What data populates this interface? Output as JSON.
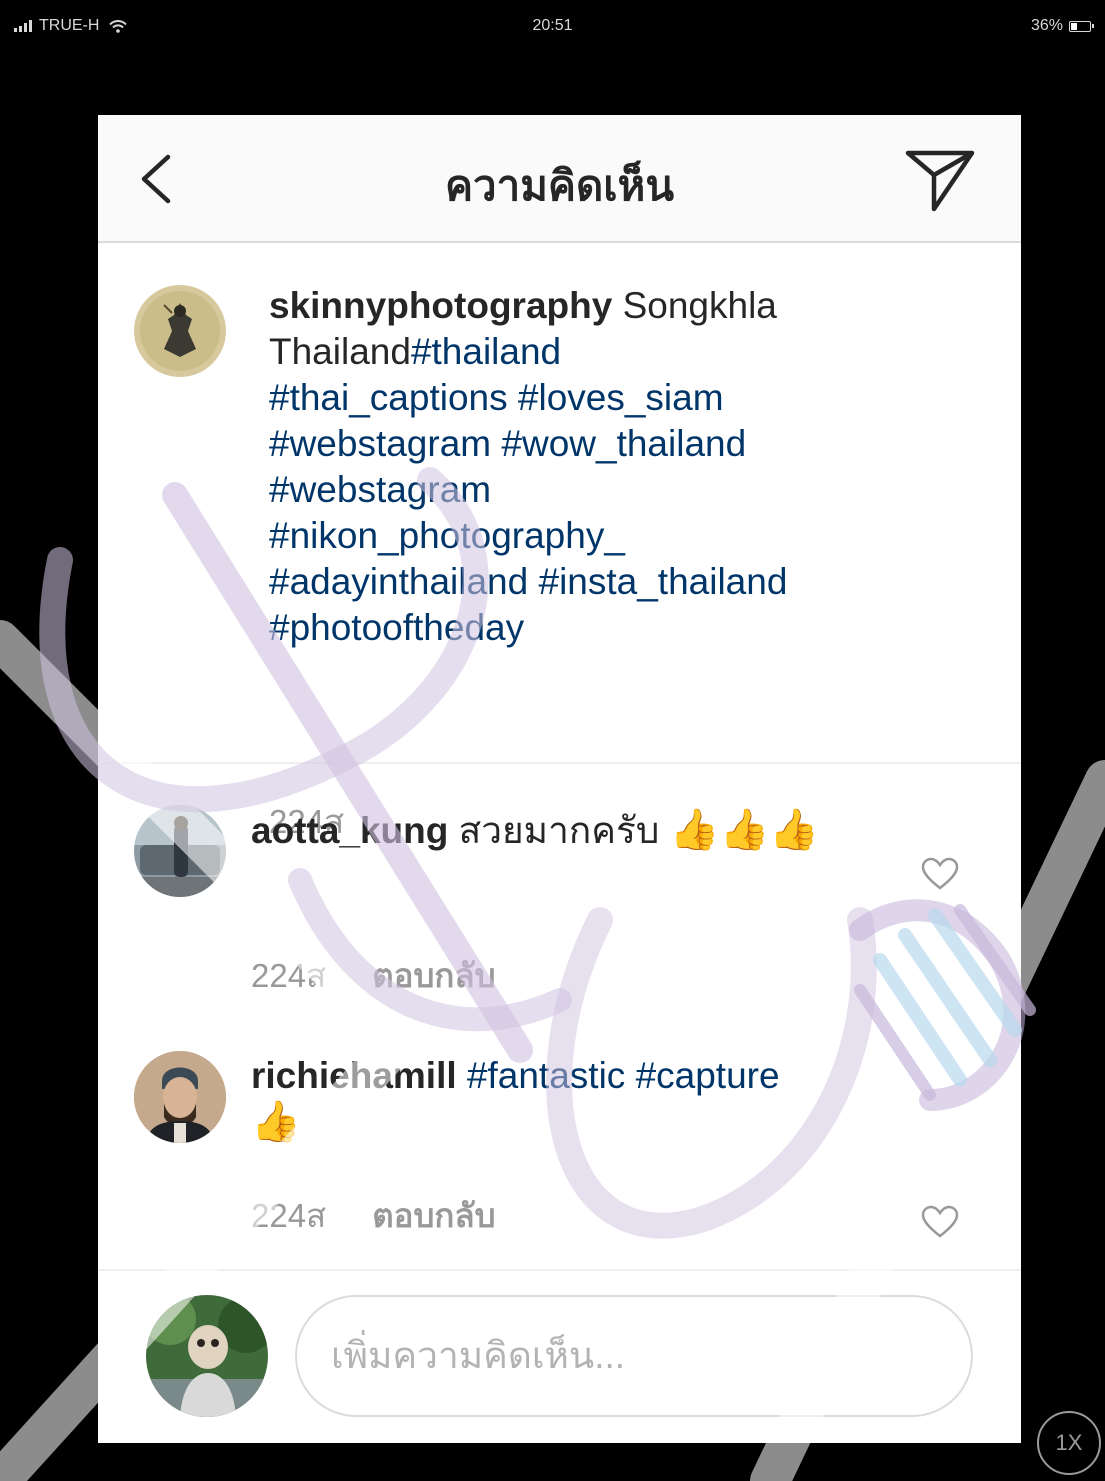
{
  "status_bar": {
    "carrier": "TRUE-H",
    "time": "20:51",
    "battery": "36%",
    "battery_level": 0.36
  },
  "nav": {
    "title": "ความคิดเห็น"
  },
  "caption": {
    "username": "skinnyphotography",
    "text_plain": "Songkhla Thailand",
    "hashtags": [
      "#thailand",
      "#thai_captions",
      "#loves_siam",
      "#webstagram",
      "#wow_thailand",
      "#webstagram",
      "#nikon_photography_",
      "#adayinthailand",
      "#insta_thailand",
      "#photooftheday"
    ],
    "time": "224ส"
  },
  "comments": [
    {
      "username": "aotta_kung",
      "text": "สวยมากครับ",
      "emoji": "👍👍👍",
      "time": "224ส",
      "reply_label": "ตอบกลับ"
    },
    {
      "username": "richiehamill",
      "hashtags": [
        "#fantastic",
        "#capture"
      ],
      "emoji": "👍",
      "time": "224ส",
      "reply_label": "ตอบกลับ"
    }
  ],
  "composer": {
    "placeholder": "เพิ่มความคิดเห็น..."
  },
  "zoom_button": {
    "label": "1X"
  },
  "icons": [
    "signal-icon",
    "wifi-icon",
    "battery-icon",
    "back-icon",
    "send-icon",
    "heart-icon"
  ],
  "colors": {
    "hashtag": "#003569",
    "text": "#262626",
    "meta": "#999999",
    "nav_background": "#fafafa",
    "watermark_purple": "#c8b8dc",
    "watermark_blue": "#b8d8ec"
  }
}
